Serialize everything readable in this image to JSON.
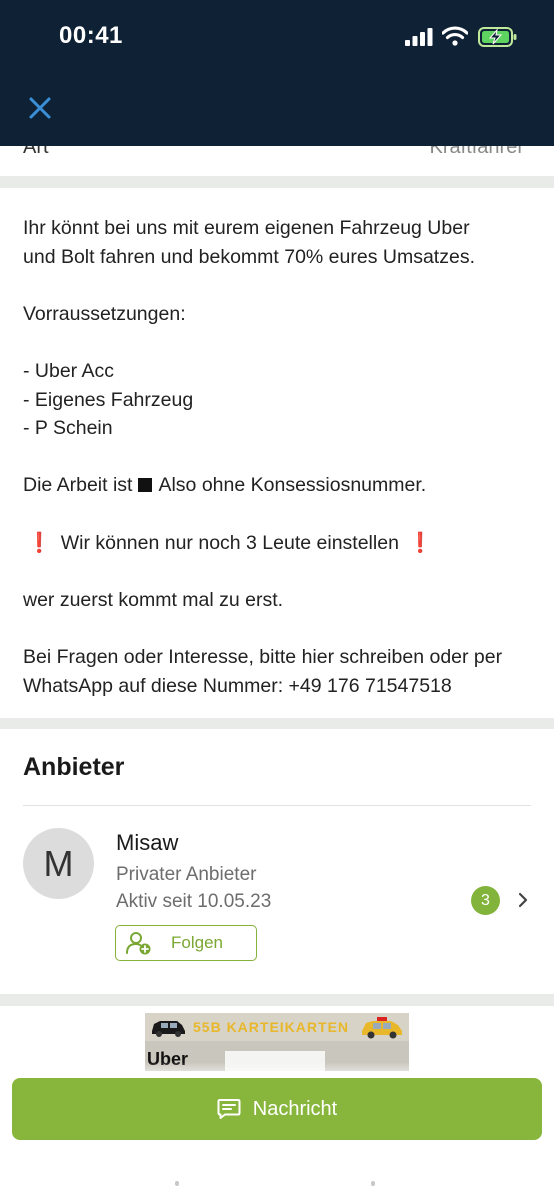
{
  "status_bar": {
    "time": "00:41"
  },
  "header": {
    "close_icon": "close-icon"
  },
  "detail_row": {
    "label": "Art",
    "value": "Kraftfahrer"
  },
  "description": {
    "lines": [
      "Ihr könnt bei uns mit eurem eigenen Fahrzeug Uber",
      "und Bolt fahren und bekommt 70% eures Umsatzes.",
      "",
      "Vorraussetzungen:",
      "",
      "- Uber Acc",
      "- Eigenes Fahrzeug",
      "- P Schein",
      "",
      "Die Arbeit ist",
      "Also ohne Konsessiosnummer.",
      "",
      "Wir können nur noch 3 Leute einstellen",
      "",
      "wer zuerst kommt mal zu erst.",
      "",
      "Bei Fragen oder Interesse, bitte hier schreiben oder per",
      "WhatsApp auf diese Nummer: +49 176 71547518"
    ],
    "exclamation": "❗"
  },
  "provider": {
    "title": "Anbieter",
    "avatar_letter": "M",
    "name": "Misaw",
    "type": "Privater Anbieter",
    "active_since": "Aktiv seit 10.05.23",
    "follow_label": "Folgen",
    "badge_count": "3"
  },
  "ad": {
    "headline": "55B KARTEIKARTEN",
    "subtext": "Uber"
  },
  "footer": {
    "message_label": "Nachricht"
  },
  "colors": {
    "header_bg": "#0f2235",
    "accent_green": "#88b63c",
    "close_blue": "#3a8fd9",
    "exclamation_red": "#d21f1f"
  }
}
